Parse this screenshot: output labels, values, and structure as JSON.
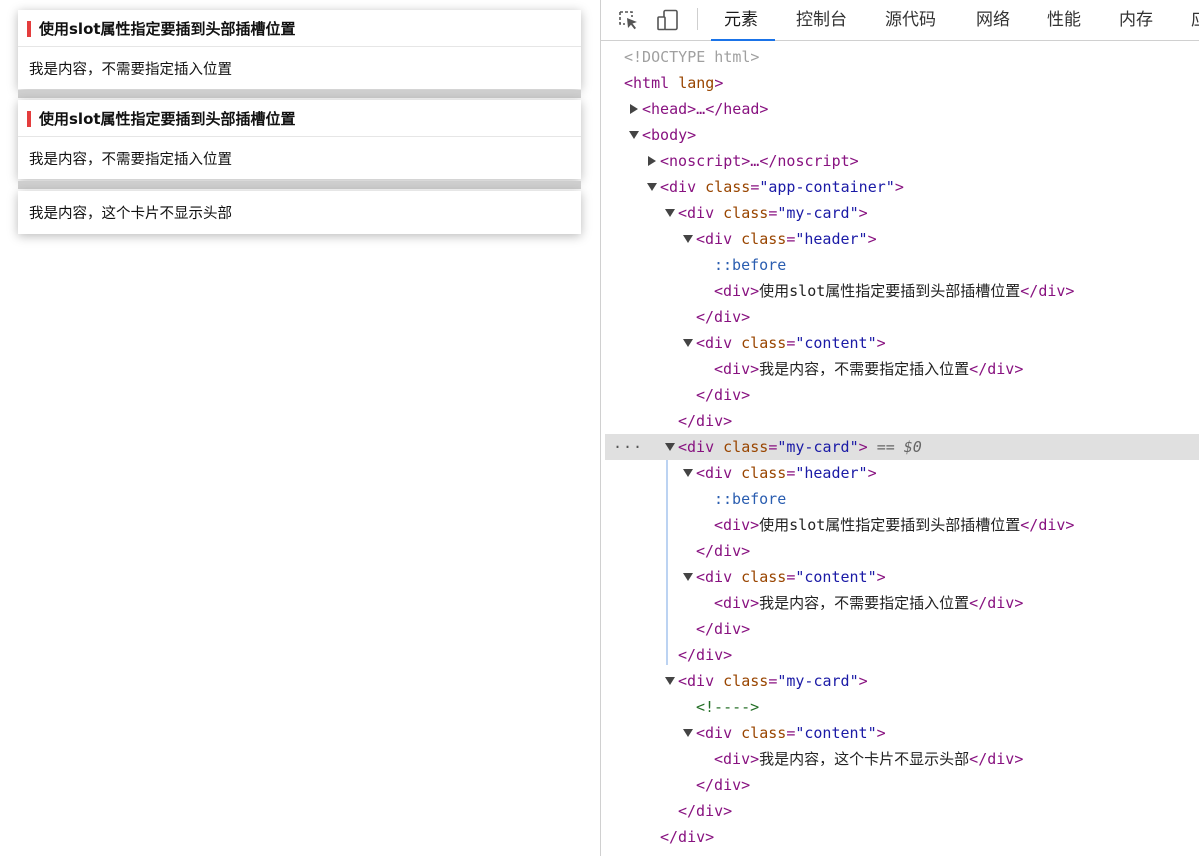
{
  "app": {
    "cards": [
      {
        "header_title": "使用slot属性指定要插到头部插槽位置",
        "content": "我是内容，不需要指定插入位置"
      },
      {
        "header_title": "使用slot属性指定要插到头部插槽位置",
        "content": "我是内容，不需要指定插入位置"
      },
      {
        "content": "我是内容，这个卡片不显示头部"
      }
    ]
  },
  "devtools": {
    "tabs": [
      "元素",
      "控制台",
      "源代码",
      "网络",
      "性能",
      "内存",
      "应"
    ],
    "active_tab": "元素",
    "accent_color": "#1a73e8",
    "tree": {
      "doctype": "<!DOCTYPE html>",
      "html_open": "<html",
      "html_attr": "lang",
      "html_close": ">",
      "head": "<head>…</head>",
      "body_open": "<body>",
      "noscript": "<noscript>…</noscript>",
      "div_open": "<div",
      "class_attr": "class",
      "eq": "=",
      "app_container_val": "\"app-container\"",
      "my_card_val": "\"my-card\"",
      "header_val": "\"header\"",
      "content_val": "\"content\"",
      "gt": ">",
      "pseudo_before": "::before",
      "div_tag_open": "<div>",
      "div_tag_close": "</div>",
      "header_text": "使用slot属性指定要插到头部插槽位置",
      "content_text": "我是内容，不需要指定插入位置",
      "content_text_3": "我是内容，这个卡片不显示头部",
      "comment": "<!---->",
      "selected_suffix": "== $0",
      "row_menu": "···"
    }
  }
}
